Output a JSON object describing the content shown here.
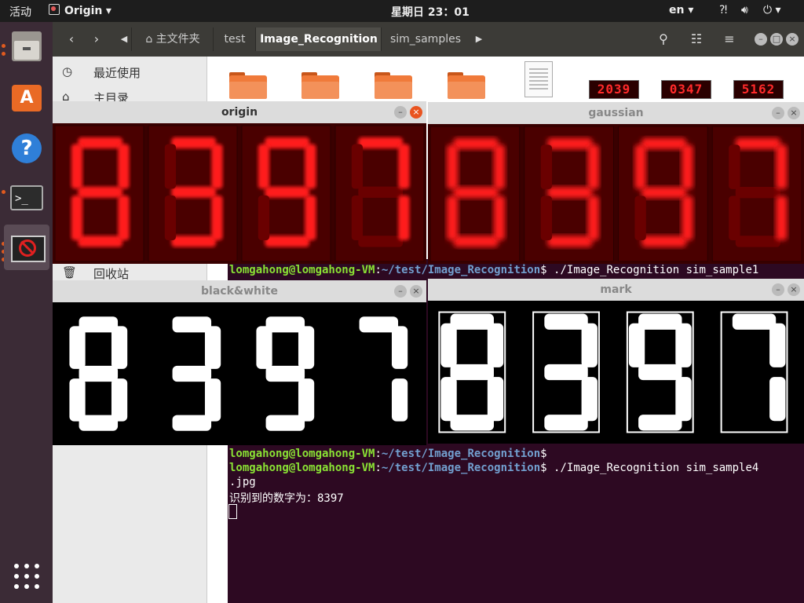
{
  "topbar": {
    "activities": "活动",
    "app_name": "Origin",
    "clock": "星期日 23：01",
    "lang": "en"
  },
  "dock": {
    "items": [
      "files-icon",
      "software-center-icon",
      "help-icon",
      "terminal-icon",
      "origin-app-icon"
    ]
  },
  "file_manager": {
    "breadcrumbs": [
      "主文件夹",
      "test",
      "Image_Recognition",
      "sim_samples"
    ],
    "current_crumb": "Image_Recognition",
    "sidebar": [
      {
        "label": "最近使用",
        "icon": "clock-icon"
      },
      {
        "label": "主目录",
        "icon": "home-icon"
      },
      {
        "label": "回收站",
        "icon": "trash-icon"
      }
    ],
    "thumbnails": [
      "2039",
      "0347",
      "5162"
    ]
  },
  "terminal": {
    "lines": [
      {
        "user": "lomgahong@lomgahong-VM",
        "sep": ":",
        "path": "~/test/Image_Recognition",
        "cmd": "$ ./Image_Recognition sim_sample1"
      },
      {
        "user": "lomgahong@lomgahong-VM",
        "sep": ":",
        "path": "~/test/Image_Recognition",
        "cmd": "$"
      },
      {
        "user": "lomgahong@lomgahong-VM",
        "sep": ":",
        "path": "~/test/Image_Recognition",
        "cmd": "$ ./Image_Recognition sim_sample4"
      },
      {
        "plain": ".jpg"
      },
      {
        "plain": "识别到的数字为：8397"
      }
    ]
  },
  "windows": {
    "origin": {
      "title": "origin",
      "digits": "8397"
    },
    "gaussian": {
      "title": "gaussian",
      "digits": "8397"
    },
    "bw": {
      "title": "black&white",
      "digits": "8397"
    },
    "mark": {
      "title": "mark",
      "digits": "8397"
    }
  },
  "colors": {
    "accent": "#e95420",
    "lcd_red": "#ff1a1a",
    "lcd_bg": "#3a0000",
    "terminal_bg": "#2d0922",
    "prompt_green": "#8ae234",
    "prompt_blue": "#729fcf"
  }
}
